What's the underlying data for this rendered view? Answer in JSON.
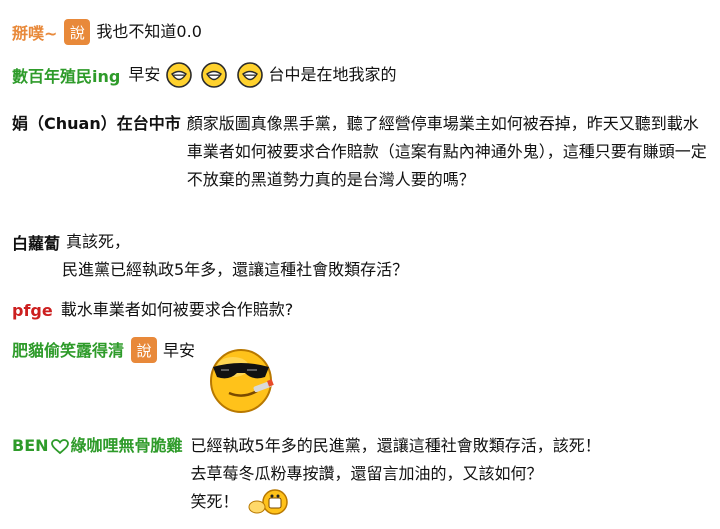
{
  "colors": {
    "name_orange": "#e8893a",
    "name_green": "#2e9b2a",
    "name_black": "#111111",
    "name_red": "#cc1f1f",
    "badge_bg": "#e8893a"
  },
  "badge_label": "說",
  "comments": [
    {
      "name": "掰噗~",
      "text": "我也不知道0.0"
    },
    {
      "name": "數百年殖民ing",
      "text_before": "早安",
      "text_after": "台中是在地我家的"
    },
    {
      "name": "娟（Chuan）在台中市",
      "text": "顏家版圖真像黑手黨，聽了經營停車場業主如何被吞掉，昨天又聽到載水車業者如何被要求合作賠款（這案有點內神通外鬼），這種只要有賺頭一定不放棄的黑道勢力真的是台灣人要的嗎？"
    },
    {
      "name": "白蘿蔔",
      "text_line1": "真該死，",
      "text_line2": "民進黨已經執政5年多，還讓這種社會敗類存活？"
    },
    {
      "name": "pfge",
      "text": "載水車業者如何被要求合作賠款?"
    },
    {
      "name": "肥貓偷笑露得清",
      "text": "早安"
    },
    {
      "name_prefix": "BEN",
      "name_suffix": "綠咖哩無骨脆雞",
      "text_line1": "已經執政5年多的民進黨，還讓這種社會敗類存活，該死！",
      "text_line2": "去草莓冬瓜粉專按讚，還留言加油的，又該如何？",
      "text_line3": "笑死！"
    }
  ]
}
